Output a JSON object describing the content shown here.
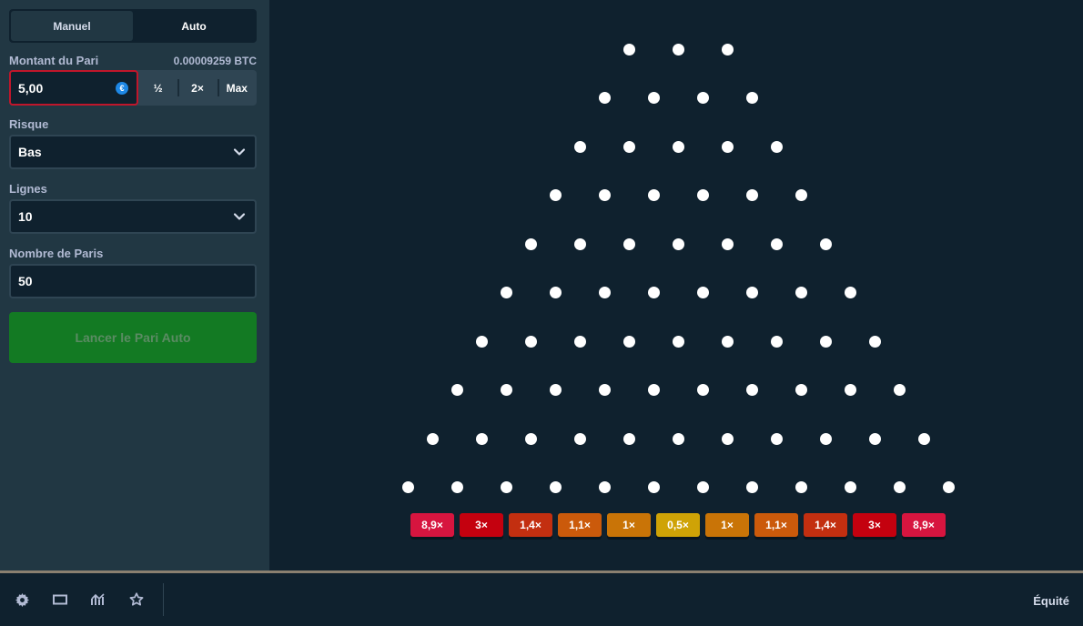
{
  "mode_toggle": {
    "manual_label": "Manuel",
    "auto_label": "Auto",
    "active": "Auto"
  },
  "bet": {
    "label": "Montant du Pari",
    "btc_value": "0.00009259 BTC",
    "amount": "5,00",
    "currency_icon": "euro-coin-icon",
    "half_label": "½",
    "double_label": "2×",
    "max_label": "Max"
  },
  "risk": {
    "label": "Risque",
    "selected": "Bas"
  },
  "lines": {
    "label": "Lignes",
    "selected": "10"
  },
  "bets_count": {
    "label": "Nombre de Paris",
    "value": "50"
  },
  "launch_button": {
    "label": "Lancer le Pari Auto"
  },
  "board": {
    "rows": 10,
    "first_row_pegs": 3,
    "multipliers": [
      {
        "label": "8,9×",
        "color": "#d7153f"
      },
      {
        "label": "3×",
        "color": "#c4010f"
      },
      {
        "label": "1,4×",
        "color": "#c32f10"
      },
      {
        "label": "1,1×",
        "color": "#cb5a0b"
      },
      {
        "label": "1×",
        "color": "#c97407"
      },
      {
        "label": "0,5×",
        "color": "#cfa306"
      },
      {
        "label": "1×",
        "color": "#c97407"
      },
      {
        "label": "1,1×",
        "color": "#cb5a0b"
      },
      {
        "label": "1,4×",
        "color": "#c32f10"
      },
      {
        "label": "3×",
        "color": "#c4010f"
      },
      {
        "label": "8,9×",
        "color": "#d7153f"
      }
    ]
  },
  "footer": {
    "icons": [
      "gear-icon",
      "theatre-mode-icon",
      "stats-icon",
      "favorite-star-icon"
    ],
    "fairness_label": "Équité"
  },
  "colors": {
    "background": "#0f212e",
    "sidebar": "#213743",
    "input_border": "#2f4553",
    "active_border": "#c0162b",
    "launch": "#137a23"
  }
}
